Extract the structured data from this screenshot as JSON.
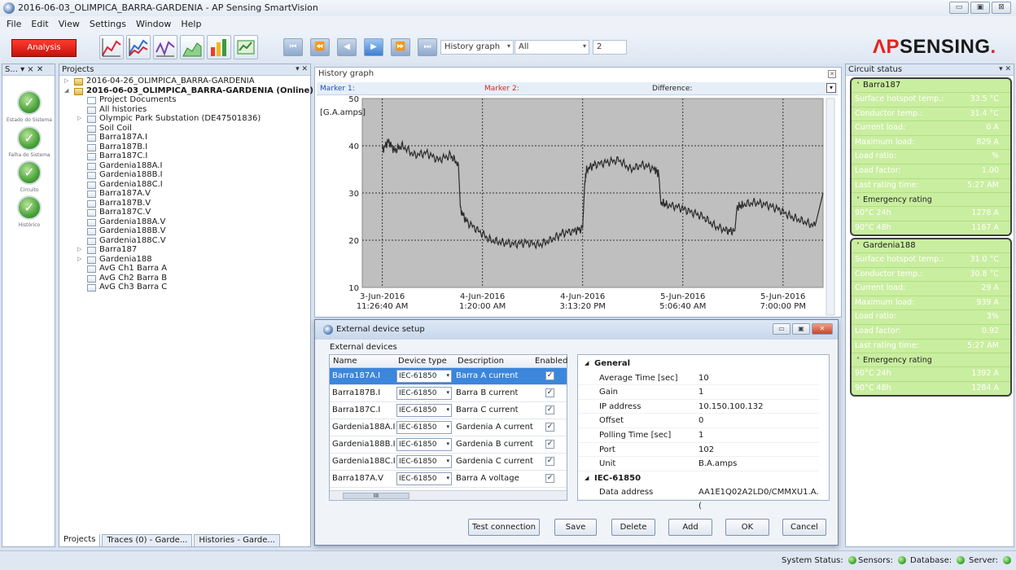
{
  "window": {
    "title": "2016-06-03_OLIMPICA_BARRA-GARDENIA - AP Sensing SmartVision",
    "controls": [
      "▭",
      "▣",
      "⊠"
    ]
  },
  "menu": [
    "File",
    "Edit",
    "View",
    "Settings",
    "Window",
    "Help"
  ],
  "toolbar": {
    "analysis_label": "Analysis",
    "history_select": "History graph",
    "scope_select": "All",
    "count_value": "2"
  },
  "brand": {
    "prefix": "ΛP",
    "suffix": "SENSING",
    "dot": "."
  },
  "left_pane": {
    "title": "S... ▾ ⨯ ✕",
    "items": [
      {
        "label": "Estado do Sistema"
      },
      {
        "label": "Falha do Sistema"
      },
      {
        "label": "Circuito"
      },
      {
        "label": "Histórico"
      }
    ]
  },
  "projects": {
    "title": "Projects",
    "tree": [
      {
        "label": "2016-04-26_OLIMPICA_BARRA-GARDENIA",
        "level": 0,
        "twisty": "▷",
        "icon": "folder"
      },
      {
        "label": "2016-06-03_OLIMPICA_BARRA-GARDENIA (Online)",
        "level": 0,
        "twisty": "◢",
        "icon": "folder",
        "bold": true
      },
      {
        "label": "Project Documents",
        "level": 1,
        "twisty": "",
        "icon": "doc"
      },
      {
        "label": "All histories",
        "level": 1,
        "twisty": "",
        "icon": "graph"
      },
      {
        "label": "Olympic Park Substation (DE47501836)",
        "level": 1,
        "twisty": "▷",
        "icon": "device"
      },
      {
        "label": "Soil Coil",
        "level": 1,
        "twisty": "",
        "icon": "graph"
      },
      {
        "label": "Barra187A.I",
        "level": 1,
        "twisty": "",
        "icon": "graph"
      },
      {
        "label": "Barra187B.I",
        "level": 1,
        "twisty": "",
        "icon": "graph"
      },
      {
        "label": "Barra187C.I",
        "level": 1,
        "twisty": "",
        "icon": "graph"
      },
      {
        "label": "Gardenia188A.I",
        "level": 1,
        "twisty": "",
        "icon": "graph"
      },
      {
        "label": "Gardenia188B.I",
        "level": 1,
        "twisty": "",
        "icon": "graph"
      },
      {
        "label": "Gardenia188C.I",
        "level": 1,
        "twisty": "",
        "icon": "graph"
      },
      {
        "label": "Barra187A.V",
        "level": 1,
        "twisty": "",
        "icon": "graph"
      },
      {
        "label": "Barra187B.V",
        "level": 1,
        "twisty": "",
        "icon": "graph"
      },
      {
        "label": "Barra187C.V",
        "level": 1,
        "twisty": "",
        "icon": "graph"
      },
      {
        "label": "Gardenia188A.V",
        "level": 1,
        "twisty": "",
        "icon": "graph"
      },
      {
        "label": "Gardenia188B.V",
        "level": 1,
        "twisty": "",
        "icon": "graph"
      },
      {
        "label": "Gardenia188C.V",
        "level": 1,
        "twisty": "",
        "icon": "graph"
      },
      {
        "label": "Barra187",
        "level": 1,
        "twisty": "▷",
        "icon": "graph"
      },
      {
        "label": "Gardenia188",
        "level": 1,
        "twisty": "▷",
        "icon": "graph"
      },
      {
        "label": "AvG Ch1 Barra A",
        "level": 1,
        "twisty": "",
        "icon": "graph"
      },
      {
        "label": "AvG Ch2 Barra B",
        "level": 1,
        "twisty": "",
        "icon": "graph"
      },
      {
        "label": "AvG Ch3 Barra C",
        "level": 1,
        "twisty": "",
        "icon": "graph"
      }
    ],
    "tabs": [
      "Projects",
      "Traces (0) - Garde...",
      "Histories - Garde..."
    ]
  },
  "history_graph": {
    "title": "History graph",
    "marker1": "Marker 1:",
    "marker2": "Marker 2:",
    "difference": "Difference:",
    "ylabel": "[G.A.amps]",
    "yticks": [
      "50",
      "40",
      "30",
      "20",
      "10"
    ],
    "xticks": [
      {
        "date": "3-Jun-2016",
        "time": "11:26:40 AM"
      },
      {
        "date": "4-Jun-2016",
        "time": "1:20:00 AM"
      },
      {
        "date": "4-Jun-2016",
        "time": "3:13:20 PM"
      },
      {
        "date": "5-Jun-2016",
        "time": "5:06:40 AM"
      },
      {
        "date": "5-Jun-2016",
        "time": "7:00:00 PM"
      }
    ]
  },
  "chart_data": {
    "type": "line",
    "title": "",
    "xlabel": "",
    "ylabel": "[G.A.amps]",
    "ylim": [
      10,
      50
    ],
    "xlim": [
      -5.0,
      110.0
    ],
    "grid": true,
    "series": [
      {
        "x": [
          0,
          1.5,
          3,
          5,
          8,
          11,
          14,
          17,
          19,
          19.5,
          21,
          24,
          27,
          30,
          33,
          36,
          39,
          42,
          45,
          48,
          50,
          50.5,
          51,
          53,
          56,
          59,
          62,
          65,
          68,
          69,
          69.5,
          71,
          74,
          77,
          80,
          83,
          86,
          88,
          88.5,
          90,
          93,
          96,
          99,
          102,
          105,
          108,
          110
        ],
        "y": [
          39,
          41,
          39,
          40,
          38,
          38.5,
          37,
          38,
          36,
          26.5,
          24,
          22,
          20,
          19.5,
          19.2,
          19.5,
          19,
          20,
          21.5,
          22,
          22.5,
          32,
          35,
          36,
          36.5,
          37,
          35,
          36,
          35,
          34,
          28,
          27.5,
          27,
          26,
          25,
          23,
          22,
          22,
          27,
          27.5,
          28,
          27.5,
          26.5,
          25,
          24,
          23,
          30
        ]
      }
    ]
  },
  "circuit_status": {
    "title": "Circuit status",
    "circuits": [
      {
        "name": "Barra187",
        "rows": [
          {
            "k": "Surface hotspot temp.:",
            "v": "33.5 °C"
          },
          {
            "k": "Conductor temp.:",
            "v": "31.4 °C"
          },
          {
            "k": "Current load:",
            "v": "0 A"
          },
          {
            "k": "Maximum load:",
            "v": "829 A"
          },
          {
            "k": "Load ratio:",
            "v": "%"
          },
          {
            "k": "Load factor:",
            "v": "1.00"
          },
          {
            "k": "Last rating time:",
            "v": "5:27 AM"
          }
        ],
        "emergency_label": "Emergency rating",
        "emergency": [
          {
            "k": "90°C 24h",
            "v": "1278 A"
          },
          {
            "k": "90°C 48h",
            "v": "1167 A"
          }
        ]
      },
      {
        "name": "Gardenia188",
        "rows": [
          {
            "k": "Surface hotspot temp.:",
            "v": "31.0 °C"
          },
          {
            "k": "Conductor temp.:",
            "v": "30.8 °C"
          },
          {
            "k": "Current load:",
            "v": "29 A"
          },
          {
            "k": "Maximum load:",
            "v": "939 A"
          },
          {
            "k": "Load ratio:",
            "v": "3%"
          },
          {
            "k": "Load factor:",
            "v": "0.92"
          },
          {
            "k": "Last rating time:",
            "v": "5:27 AM"
          }
        ],
        "emergency_label": "Emergency rating",
        "emergency": [
          {
            "k": "90°C 24h",
            "v": "1392 A"
          },
          {
            "k": "90°C 48h",
            "v": "1284 A"
          }
        ]
      }
    ]
  },
  "dialog": {
    "title": "External device setup",
    "section": "External devices",
    "columns": [
      "Name",
      "Device type",
      "Description",
      "Enabled"
    ],
    "rows": [
      {
        "name": "Barra187A.I",
        "type": "IEC-61850",
        "desc": "Barra A current",
        "enabled": "✓"
      },
      {
        "name": "Barra187B.I",
        "type": "IEC-61850",
        "desc": "Barra B current",
        "enabled": "✓"
      },
      {
        "name": "Barra187C.I",
        "type": "IEC-61850",
        "desc": "Barra C current",
        "enabled": "✓"
      },
      {
        "name": "Gardenia188A.I",
        "type": "IEC-61850",
        "desc": "Gardenia A current",
        "enabled": "✓"
      },
      {
        "name": "Gardenia188B.I",
        "type": "IEC-61850",
        "desc": "Gardenia B current",
        "enabled": "✓"
      },
      {
        "name": "Gardenia188C.I",
        "type": "IEC-61850",
        "desc": "Gardenia C current",
        "enabled": "✓"
      },
      {
        "name": "Barra187A.V",
        "type": "IEC-61850",
        "desc": "Barra A voltage",
        "enabled": "✓"
      }
    ],
    "properties": {
      "general_label": "General",
      "general": [
        {
          "k": "Average Time [sec]",
          "v": "10"
        },
        {
          "k": "Gain",
          "v": "1"
        },
        {
          "k": "IP address",
          "v": "10.150.100.132"
        },
        {
          "k": "Offset",
          "v": "0"
        },
        {
          "k": "Polling Time [sec]",
          "v": "1"
        },
        {
          "k": "Port",
          "v": "102"
        },
        {
          "k": "Unit",
          "v": "B.A.amps"
        }
      ],
      "iec_label": "IEC-61850",
      "iec": [
        {
          "k": "Data address",
          "v": "AA1E1Q02A2LD0/CMMXU1.A.("
        }
      ]
    },
    "buttons": {
      "test": "Test connection",
      "save": "Save",
      "delete": "Delete",
      "add": "Add",
      "ok": "OK",
      "cancel": "Cancel"
    }
  },
  "statusbar": {
    "system_status": "System Status:",
    "sensors": "Sensors:",
    "database": "Database:",
    "server": "Server:"
  }
}
